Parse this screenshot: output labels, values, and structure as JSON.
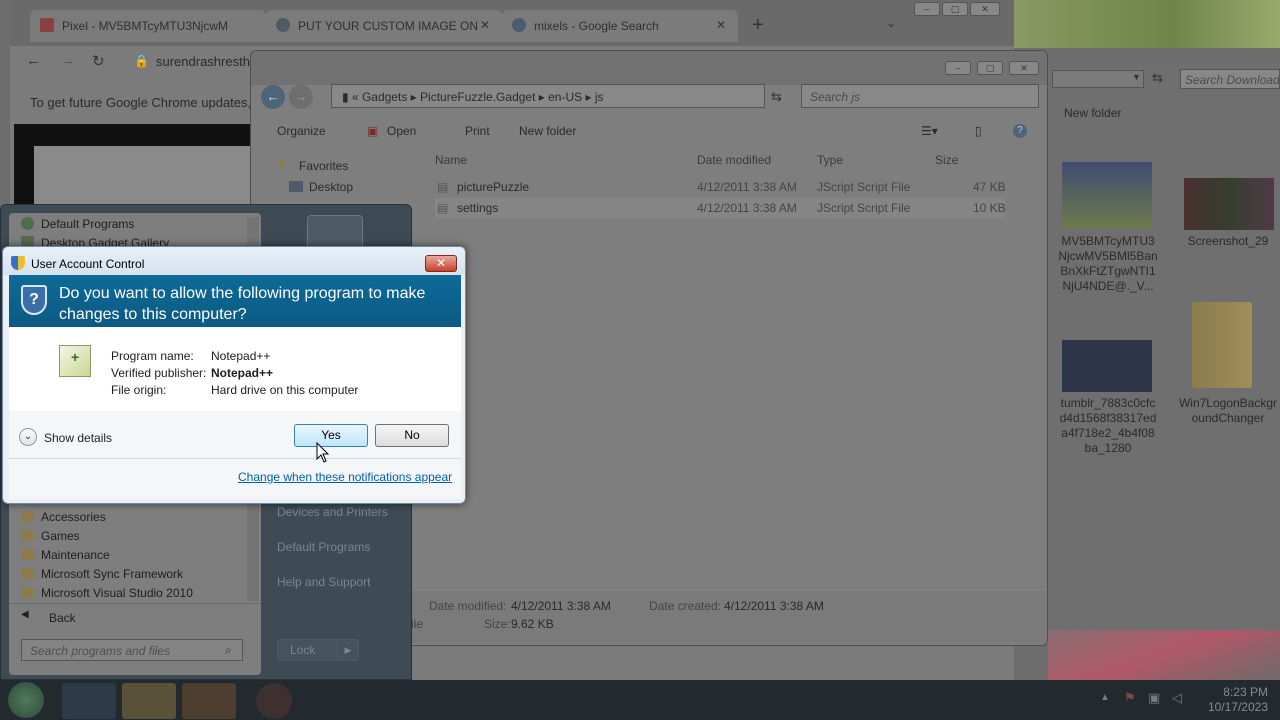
{
  "chrome": {
    "tabs": [
      {
        "label": "Pixel - MV5BMTcyMTU3NjcwM"
      },
      {
        "label": "PUT YOUR CUSTOM IMAGE ON"
      },
      {
        "label": "mixels - Google Search"
      }
    ],
    "new_tab": "+",
    "address": "surendrashrestha",
    "update_notice": "To get future Google Chrome updates,"
  },
  "explorer": {
    "breadcrumb": [
      "Gadgets",
      "PictureFuzzle.Gadget",
      "en-US",
      "js"
    ],
    "search_placeholder": "Search js",
    "toolbar": {
      "organize": "Organize",
      "open": "Open",
      "print": "Print",
      "new_folder": "New folder"
    },
    "columns": {
      "name": "Name",
      "date": "Date modified",
      "type": "Type",
      "size": "Size"
    },
    "nav": {
      "favorites": "Favorites",
      "desktop": "Desktop"
    },
    "files": [
      {
        "name": "picturePuzzle",
        "date": "4/12/2011 3:38 AM",
        "type": "JScript Script File",
        "size": "47 KB"
      },
      {
        "name": "settings",
        "date": "4/12/2011 3:38 AM",
        "type": "JScript Script File",
        "size": "10 KB"
      }
    ],
    "details": {
      "date_modified_label": "Date modified:",
      "date_modified": "4/12/2011 3:38 AM",
      "date_created_label": "Date created:",
      "date_created": "4/12/2011 3:38 AM",
      "file_label": "ile",
      "size_label": "Size:",
      "size": "9.62 KB"
    }
  },
  "right_explorer": {
    "search_placeholder": "Search Download",
    "new_folder": "New folder",
    "items": [
      {
        "caption": "MV5BMTcyMTU3NjcwMV5BMl5BanBnXkFtZTgwNTI1NjU4NDE@._V..."
      },
      {
        "caption": "Screenshot_29"
      },
      {
        "caption": "tumblr_7883c0cfcd4d1568f38317eda4f718e2_4b4f08ba_1280"
      },
      {
        "caption": "Win7LogonBackgroundChanger"
      }
    ]
  },
  "start_menu": {
    "top_items": [
      "Default Programs",
      "Desktop Gadget Gallery"
    ],
    "folders": [
      "Accessories",
      "Games",
      "Maintenance",
      "Microsoft Sync Framework",
      "Microsoft Visual Studio 2010"
    ],
    "back": "Back",
    "search_placeholder": "Search programs and files",
    "right_links": [
      "Devices and Printers",
      "Default Programs",
      "Help and Support"
    ],
    "lock": "Lock"
  },
  "uac": {
    "title": "User Account Control",
    "question": "Do you want to allow the following program to make changes to this computer?",
    "program_name_label": "Program name:",
    "program_name": "Notepad++",
    "publisher_label": "Verified publisher:",
    "publisher": "Notepad++",
    "origin_label": "File origin:",
    "origin": "Hard drive on this computer",
    "show_details": "Show details",
    "yes": "Yes",
    "no": "No",
    "change_link": "Change when these notifications appear"
  },
  "taskbar": {
    "time": "8:23 PM",
    "date": "10/17/2023"
  },
  "colors": {
    "uac_banner": "#0d6b96",
    "link": "#0060b0"
  }
}
